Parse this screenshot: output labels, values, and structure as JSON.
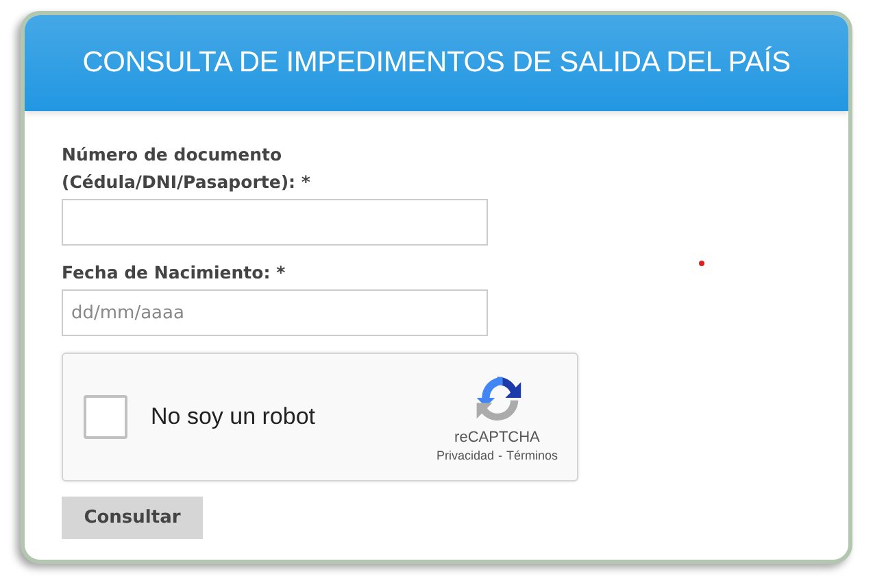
{
  "title": "CONSULTA DE IMPEDIMENTOS DE SALIDA DEL PAÍS",
  "fields": [
    {
      "label": "Número de documento (Cédula/DNI/Pasaporte):",
      "required": "*"
    },
    {
      "label": "Fecha de Nacimiento:",
      "required": "*",
      "placeholder": "dd/mm/aaaa"
    }
  ],
  "captcha": {
    "label": "No soy un robot",
    "checked": false,
    "brand": "reCAPTCHA",
    "privacy": "Privacidad",
    "separator": "-",
    "terms": "Términos"
  },
  "submit": "Consultar"
}
